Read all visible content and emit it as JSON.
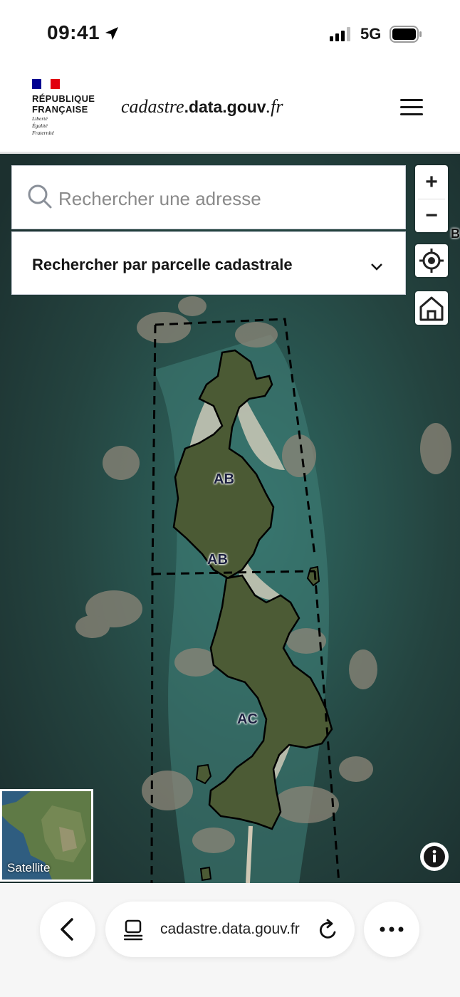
{
  "status_bar": {
    "time": "09:41",
    "network": "5G",
    "icons": [
      "location-arrow-icon",
      "signal-icon",
      "battery-icon"
    ]
  },
  "header": {
    "gov_line1": "RÉPUBLIQUE",
    "gov_line2": "FRANÇAISE",
    "motto_1": "Liberté",
    "motto_2": "Égalité",
    "motto_3": "Fraternité",
    "title_italic": "cadastre",
    "title_bold": ".data.gouv",
    "title_suffix": ".fr",
    "menu_icon": "hamburger-menu-icon",
    "flag_colors": [
      "#000091",
      "#ffffff",
      "#e1000f"
    ]
  },
  "search": {
    "placeholder": "Rechercher une adresse",
    "parcel_label": "Rechercher par parcelle cadastrale"
  },
  "map_controls": {
    "zoom_in": "+",
    "zoom_out": "−",
    "icons": [
      "locate-icon",
      "home-icon",
      "info-icon"
    ]
  },
  "map": {
    "edge_label": "B",
    "parcels": [
      {
        "label": "AB"
      },
      {
        "label": "AB"
      },
      {
        "label": "AC"
      }
    ],
    "minimap_label": "Satellite"
  },
  "browser": {
    "url": "cadastre.data.gouv.fr",
    "icons": [
      "back-icon",
      "tabs-icon",
      "reload-icon",
      "more-icon"
    ]
  }
}
